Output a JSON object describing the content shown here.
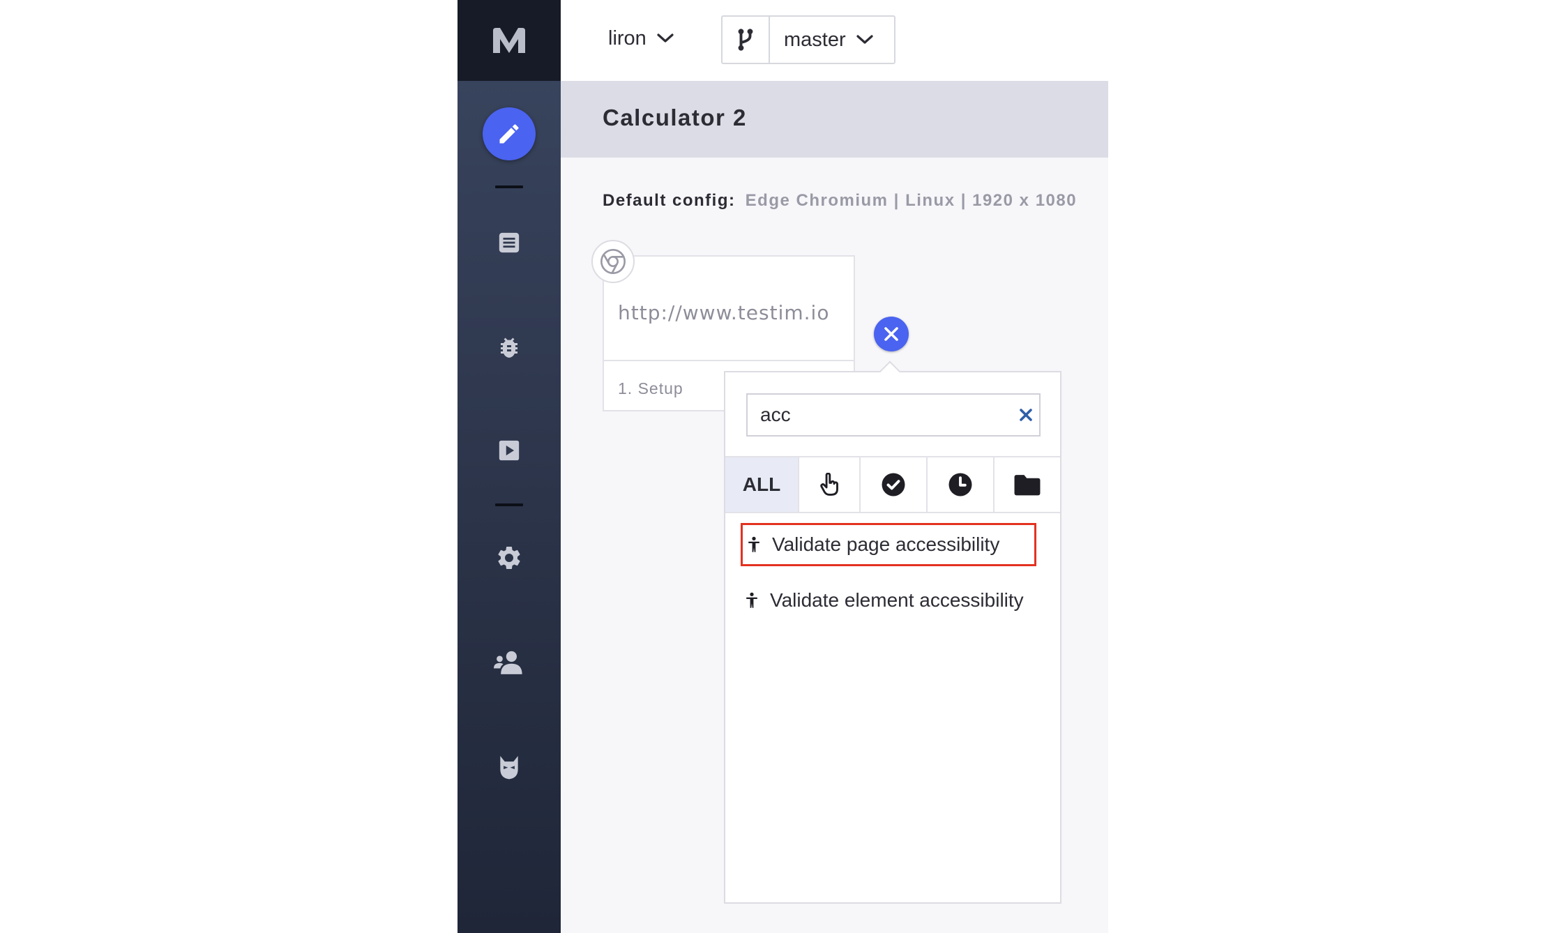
{
  "topbar": {
    "project": "liron",
    "branch": "master"
  },
  "page": {
    "title": "Calculator 2"
  },
  "config": {
    "label": "Default config:",
    "value": "Edge Chromium | Linux | 1920 x 1080"
  },
  "step_card": {
    "url": "http://www.testim.io",
    "step_label": "1. Setup",
    "browser_icon": "chrome-icon"
  },
  "popup": {
    "search_value": "acc",
    "filters": [
      {
        "label": "ALL",
        "icon": null,
        "selected": true
      },
      {
        "label": "",
        "icon": "pointer-icon",
        "selected": false
      },
      {
        "label": "",
        "icon": "check-circle-icon",
        "selected": false
      },
      {
        "label": "",
        "icon": "clock-icon",
        "selected": false
      },
      {
        "label": "",
        "icon": "folder-icon",
        "selected": false
      }
    ],
    "results": [
      {
        "label": "Validate page accessibility",
        "icon": "accessibility-icon",
        "highlighted": true
      },
      {
        "label": "Validate element accessibility",
        "icon": "accessibility-icon",
        "highlighted": false
      }
    ]
  },
  "sidebar": {
    "items": [
      "edit-icon",
      "list-icon",
      "bug-icon",
      "play-icon",
      "gear-icon",
      "users-icon",
      "mask-icon"
    ]
  },
  "colors": {
    "accent": "#4a63f0",
    "highlight": "#e33220",
    "title_band": "#dcdce6"
  }
}
